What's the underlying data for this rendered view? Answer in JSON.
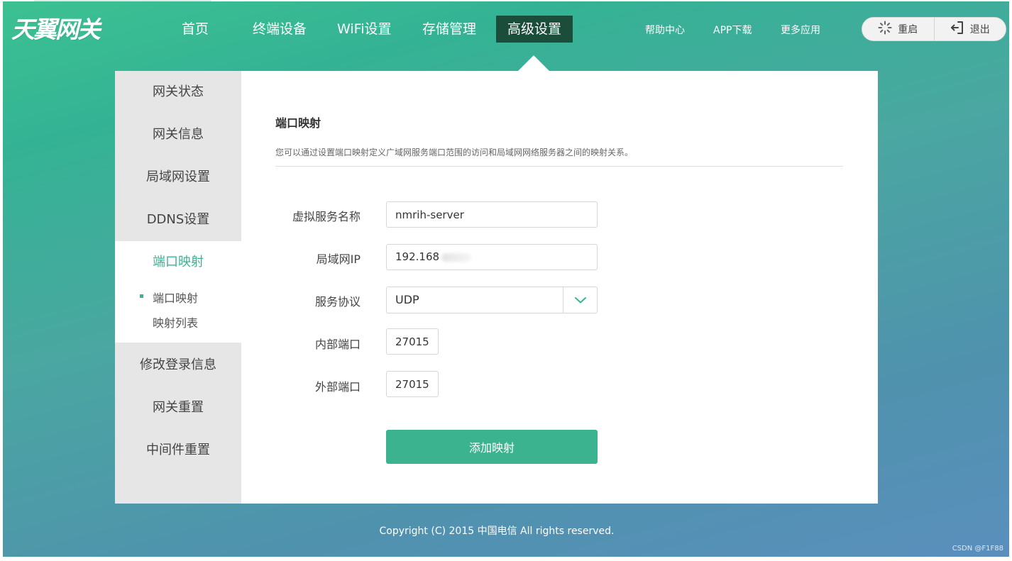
{
  "header": {
    "logo": "天翼网关",
    "nav": [
      {
        "label": "首页"
      },
      {
        "label": "终端设备"
      },
      {
        "label": "WiFi设置"
      },
      {
        "label": "存储管理"
      },
      {
        "label": "高级设置",
        "active": true
      }
    ],
    "links": {
      "help": "帮助中心",
      "app": "APP下载",
      "more": "更多应用"
    },
    "actions": {
      "restart": "重启",
      "logout": "退出"
    }
  },
  "sidebar": {
    "items": [
      {
        "label": "网关状态"
      },
      {
        "label": "网关信息"
      },
      {
        "label": "局域网设置"
      },
      {
        "label": "DDNS设置"
      },
      {
        "label": "端口映射",
        "active": true
      },
      {
        "label": "修改登录信息"
      },
      {
        "label": "网关重置"
      },
      {
        "label": "中间件重置"
      }
    ],
    "subitems": [
      {
        "label": "端口映射",
        "active": true
      },
      {
        "label": "映射列表"
      }
    ]
  },
  "content": {
    "title": "端口映射",
    "description": "您可以通过设置端口映射定义广域网服务端口范围的访问和局域网网络服务器之间的映射关系。",
    "form": {
      "service_name": {
        "label": "虚拟服务名称",
        "value": "nmrih-server"
      },
      "lan_ip": {
        "label": "局域网IP",
        "value": "192.168"
      },
      "protocol": {
        "label": "服务协议",
        "value": "UDP"
      },
      "internal_port": {
        "label": "内部端口",
        "value": "27015"
      },
      "external_port": {
        "label": "外部端口",
        "value": "27015"
      }
    },
    "submit": "添加映射"
  },
  "footer": "Copyright (C) 2015 中国电信 All rights reserved.",
  "watermark": "CSDN @F1F88",
  "colors": {
    "accent": "#3cb38f",
    "nav_active": "#1a4d3a"
  }
}
